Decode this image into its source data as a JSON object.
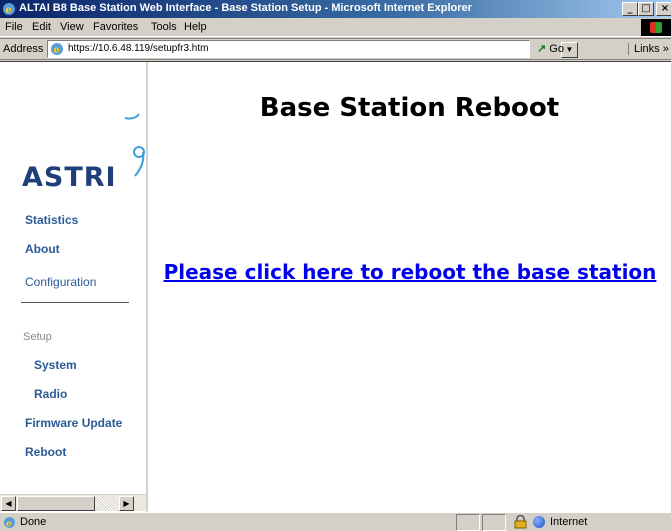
{
  "window": {
    "title": "ALTAI B8 Base Station Web Interface - Base Station Setup - Microsoft Internet Explorer",
    "minimize": "_",
    "maximize": "□",
    "close": "×"
  },
  "menu": [
    "File",
    "Edit",
    "View",
    "Favorites",
    "Tools",
    "Help"
  ],
  "address_bar": {
    "label": "Address",
    "url": "https://10.6.48.119/setupfr3.htm",
    "go_label": "Go",
    "links_label": "Links »"
  },
  "left_nav": {
    "logo_text": "ASTRI",
    "items": [
      {
        "label": "Statistics"
      },
      {
        "label": "About"
      },
      {
        "label": "Configuration"
      }
    ],
    "setup_heading": "Setup",
    "setup_items": [
      {
        "label": "System"
      },
      {
        "label": "Radio"
      },
      {
        "label": "Firmware Update"
      },
      {
        "label": "Reboot"
      }
    ]
  },
  "main": {
    "heading": "Base Station Reboot",
    "reboot_link": "Please click here to reboot the base station"
  },
  "status_bar": {
    "status": "Done",
    "zone": "Internet"
  },
  "colors": {
    "title_bar": "#0a246a",
    "nav_link": "#2b5b96",
    "link": "#0000ee",
    "logo": "#1e3f7a",
    "chrome": "#d4d0c8"
  }
}
